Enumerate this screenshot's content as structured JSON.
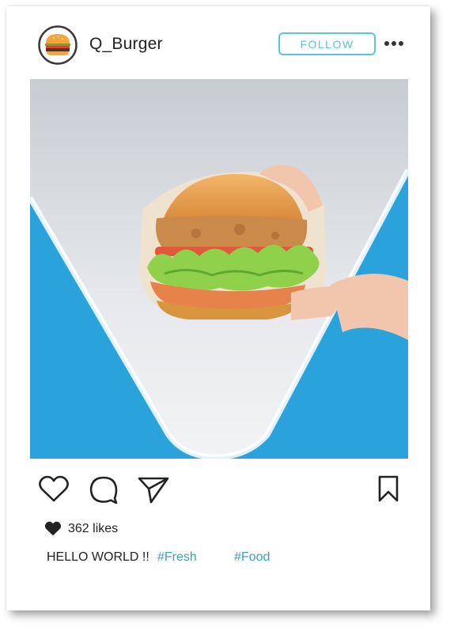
{
  "post": {
    "username": "Q_Burger",
    "follow_label": "FOLLOW",
    "likes_text": "362 likes",
    "caption": "HELLO WORLD !!",
    "hashtags": [
      "#Fresh",
      "#Food"
    ]
  },
  "icons": {
    "avatar": "burger-icon",
    "more": "more-dots-icon",
    "like": "heart-outline-icon",
    "comment": "comment-bubble-icon",
    "share": "paper-plane-icon",
    "save": "bookmark-icon",
    "likes_heart": "heart-filled-icon"
  },
  "colors": {
    "accent": "#5bc4dd",
    "hashtag": "#3a9fc8",
    "photo_background": "#2a9fd8"
  }
}
